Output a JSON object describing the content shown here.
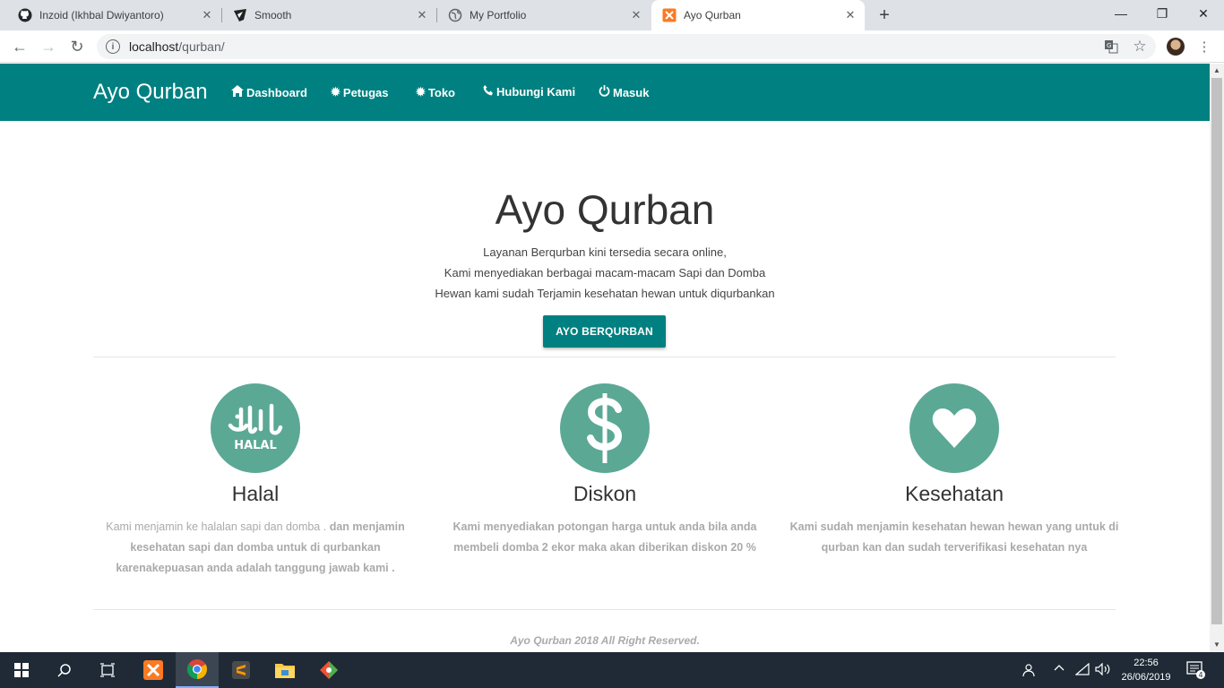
{
  "browser": {
    "tabs": [
      {
        "title": "Inzoid (Ikhbal Dwiyantoro)",
        "icon": "github-icon"
      },
      {
        "title": "Smooth",
        "icon": "smooth-icon"
      },
      {
        "title": "My Portfolio",
        "icon": "globe-icon"
      },
      {
        "title": "Ayo Qurban",
        "icon": "xampp-icon"
      }
    ],
    "url_host": "localhost",
    "url_path": "/qurban/"
  },
  "site": {
    "brand": "Ayo Qurban",
    "nav": [
      {
        "label": "Dashboard",
        "icon": "home-icon"
      },
      {
        "label": "Petugas",
        "icon": "gear-icon"
      },
      {
        "label": "Toko",
        "icon": "gear-icon"
      },
      {
        "label": "Hubungi Kami",
        "icon": "phone-icon"
      },
      {
        "label": "Masuk",
        "icon": "power-icon"
      }
    ]
  },
  "hero": {
    "title": "Ayo Qurban",
    "lines": [
      "Layanan Berqurban kini tersedia secara online,",
      "Kami menyediakan berbagai macam-macam Sapi dan Domba",
      "Hewan kami sudah Terjamin kesehatan hewan untuk diqurbankan"
    ],
    "button": "AYO BERQURBAN"
  },
  "features": [
    {
      "title": "Halal",
      "icon": "halal-icon",
      "icon_text": "HALAL",
      "desc_light": "Kami menjamin ke halalan sapi dan domba .",
      "desc_bold": " dan menjamin kesehatan sapi dan domba untuk di qurbankan karenakepuasan anda adalah tanggung jawab kami ."
    },
    {
      "title": "Diskon",
      "icon": "dollar-icon",
      "desc_light": "",
      "desc_bold": "Kami menyediakan potongan harga untuk anda bila anda membeli domba 2 ekor maka akan diberikan diskon 20 %"
    },
    {
      "title": "Kesehatan",
      "icon": "heart-icon",
      "desc_light": "",
      "desc_bold": "Kami sudah menjamin kesehatan hewan hewan yang untuk di qurban kan dan sudah terverifikasi kesehatan nya"
    }
  ],
  "footer": "Ayo Qurban 2018 All Right Reserved.",
  "taskbar": {
    "time": "22:56",
    "date": "26/06/2019",
    "notifications": "4"
  },
  "colors": {
    "primary": "#008080",
    "feature_circle": "#5ba895"
  }
}
